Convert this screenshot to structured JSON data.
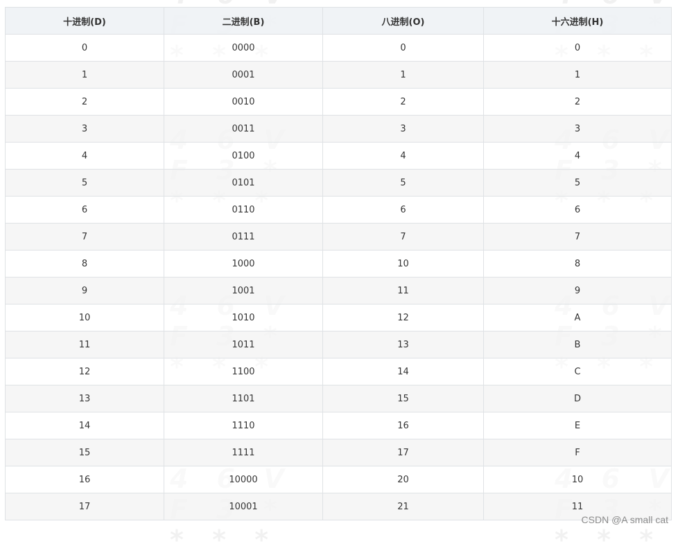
{
  "table": {
    "headers": [
      "十进制(D)",
      "二进制(B)",
      "八进制(O)",
      "十六进制(H)"
    ],
    "rows": [
      [
        "0",
        "0000",
        "0",
        "0"
      ],
      [
        "1",
        "0001",
        "1",
        "1"
      ],
      [
        "2",
        "0010",
        "2",
        "2"
      ],
      [
        "3",
        "0011",
        "3",
        "3"
      ],
      [
        "4",
        "0100",
        "4",
        "4"
      ],
      [
        "5",
        "0101",
        "5",
        "5"
      ],
      [
        "6",
        "0110",
        "6",
        "6"
      ],
      [
        "7",
        "0111",
        "7",
        "7"
      ],
      [
        "8",
        "1000",
        "10",
        "8"
      ],
      [
        "9",
        "1001",
        "11",
        "9"
      ],
      [
        "10",
        "1010",
        "12",
        "A"
      ],
      [
        "11",
        "1011",
        "13",
        "B"
      ],
      [
        "12",
        "1100",
        "14",
        "C"
      ],
      [
        "13",
        "1101",
        "15",
        "D"
      ],
      [
        "14",
        "1110",
        "16",
        "E"
      ],
      [
        "15",
        "1111",
        "17",
        "F"
      ],
      [
        "16",
        "10000",
        "20",
        "10"
      ],
      [
        "17",
        "10001",
        "21",
        "11"
      ]
    ]
  },
  "watermark": {
    "line1": "4 6 V",
    "line2": "F 3 *",
    "line3": "* * *"
  },
  "credit": "CSDN @A small cat",
  "colors": {
    "header_bg": "#eff2f5",
    "border": "#dfe2e5",
    "stripe": "#f5f5f5"
  }
}
